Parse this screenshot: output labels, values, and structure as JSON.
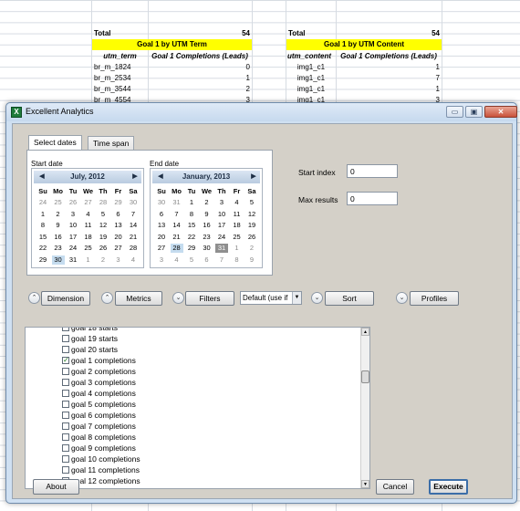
{
  "sheet": {
    "left": {
      "total_label": "Total",
      "total_value": "54",
      "header": "Goal 1 by UTM Term",
      "col1": "utm_term",
      "col2": "Goal 1 Completions (Leads)",
      "rows": [
        {
          "k": "br_m_1824",
          "v": "0"
        },
        {
          "k": "br_m_2534",
          "v": "1"
        },
        {
          "k": "br_m_3544",
          "v": "2"
        },
        {
          "k": "br_m_4554",
          "v": "3"
        }
      ]
    },
    "right": {
      "total_label": "Total",
      "total_value": "54",
      "header": "Goal 1 by UTM Content",
      "col1": "utm_content",
      "col2": "Goal 1 Completions (Leads)",
      "rows": [
        {
          "k": "img1_c1",
          "v": "1"
        },
        {
          "k": "img1_c1",
          "v": "7"
        },
        {
          "k": "img1_c1",
          "v": "1"
        },
        {
          "k": "img1_c1",
          "v": "3"
        }
      ]
    }
  },
  "window": {
    "title": "Excellent Analytics",
    "app_icon_letter": "X",
    "minimize": "▭",
    "maximize": "▣",
    "close": "✕"
  },
  "tabs": {
    "select_dates": "Select dates",
    "time_span": "Time span"
  },
  "calendar": {
    "days_of_week": [
      "Su",
      "Mo",
      "Tu",
      "We",
      "Th",
      "Fr",
      "Sa"
    ],
    "start": {
      "label": "Start date",
      "month": "July, 2012",
      "weeks": [
        [
          "24",
          "25",
          "26",
          "27",
          "28",
          "29",
          "30"
        ],
        [
          "1",
          "2",
          "3",
          "4",
          "5",
          "6",
          "7"
        ],
        [
          "8",
          "9",
          "10",
          "11",
          "12",
          "13",
          "14"
        ],
        [
          "15",
          "16",
          "17",
          "18",
          "19",
          "20",
          "21"
        ],
        [
          "22",
          "23",
          "24",
          "25",
          "26",
          "27",
          "28"
        ],
        [
          "29",
          "30",
          "31",
          "1",
          "2",
          "3",
          "4"
        ]
      ],
      "selected": "30"
    },
    "end": {
      "label": "End date",
      "month": "January, 2013",
      "weeks": [
        [
          "30",
          "31",
          "1",
          "2",
          "3",
          "4",
          "5"
        ],
        [
          "6",
          "7",
          "8",
          "9",
          "10",
          "11",
          "12"
        ],
        [
          "13",
          "14",
          "15",
          "16",
          "17",
          "18",
          "19"
        ],
        [
          "20",
          "21",
          "22",
          "23",
          "24",
          "25",
          "26"
        ],
        [
          "27",
          "28",
          "29",
          "30",
          "31",
          "1",
          "2"
        ],
        [
          "3",
          "4",
          "5",
          "6",
          "7",
          "8",
          "9"
        ]
      ],
      "selected": "28",
      "today": "31"
    }
  },
  "fields": {
    "start_index_label": "Start index",
    "start_index_value": "0",
    "max_results_label": "Max results",
    "max_results_value": "0"
  },
  "toolbar": {
    "dimension": "Dimension",
    "metrics": "Metrics",
    "filters": "Filters",
    "segment_value": "Default (use if",
    "sort": "Sort",
    "profiles": "Profiles"
  },
  "metrics_list": [
    {
      "label": "goal 18 starts",
      "checked": false
    },
    {
      "label": "goal 19 starts",
      "checked": false
    },
    {
      "label": "goal 20 starts",
      "checked": false
    },
    {
      "label": "goal 1 completions",
      "checked": true
    },
    {
      "label": "goal 2 completions",
      "checked": false
    },
    {
      "label": "goal 3 completions",
      "checked": false
    },
    {
      "label": "goal 4 completions",
      "checked": false
    },
    {
      "label": "goal 5 completions",
      "checked": false
    },
    {
      "label": "goal 6 completions",
      "checked": false
    },
    {
      "label": "goal 7 completions",
      "checked": false
    },
    {
      "label": "goal 8 completions",
      "checked": false
    },
    {
      "label": "goal 9 completions",
      "checked": false
    },
    {
      "label": "goal 10 completions",
      "checked": false
    },
    {
      "label": "goal 11 completions",
      "checked": false
    },
    {
      "label": "goal 12 completions",
      "checked": false
    }
  ],
  "footer": {
    "about": "About",
    "cancel": "Cancel",
    "execute": "Execute"
  },
  "colors": {
    "header_yellow": "#ffff00",
    "window_frame": "#cfe0f2",
    "client_bg": "#d4d0c8"
  }
}
